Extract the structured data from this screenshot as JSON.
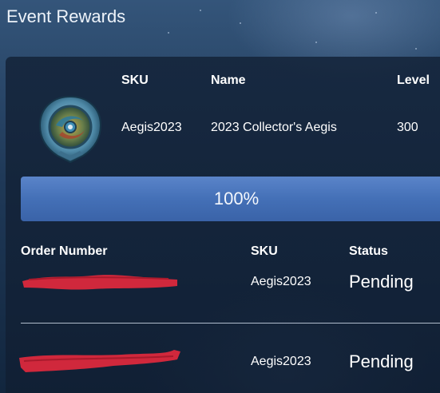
{
  "page": {
    "title": "Event Rewards"
  },
  "item": {
    "icon": "aegis-shield-icon",
    "headers": {
      "sku": "SKU",
      "name": "Name",
      "level": "Level"
    },
    "sku": "Aegis2023",
    "name": "2023 Collector's Aegis",
    "level": "300"
  },
  "progress": {
    "value": 1.0,
    "label": "100%",
    "color": "#4a76bd"
  },
  "orders": {
    "headers": {
      "order_number": "Order Number",
      "sku": "SKU",
      "status": "Status"
    },
    "rows": [
      {
        "sku": "Aegis2023",
        "status": "Pending"
      },
      {
        "sku": "Aegis2023",
        "status": "Pending"
      }
    ],
    "redaction_color": "#d0283c"
  }
}
